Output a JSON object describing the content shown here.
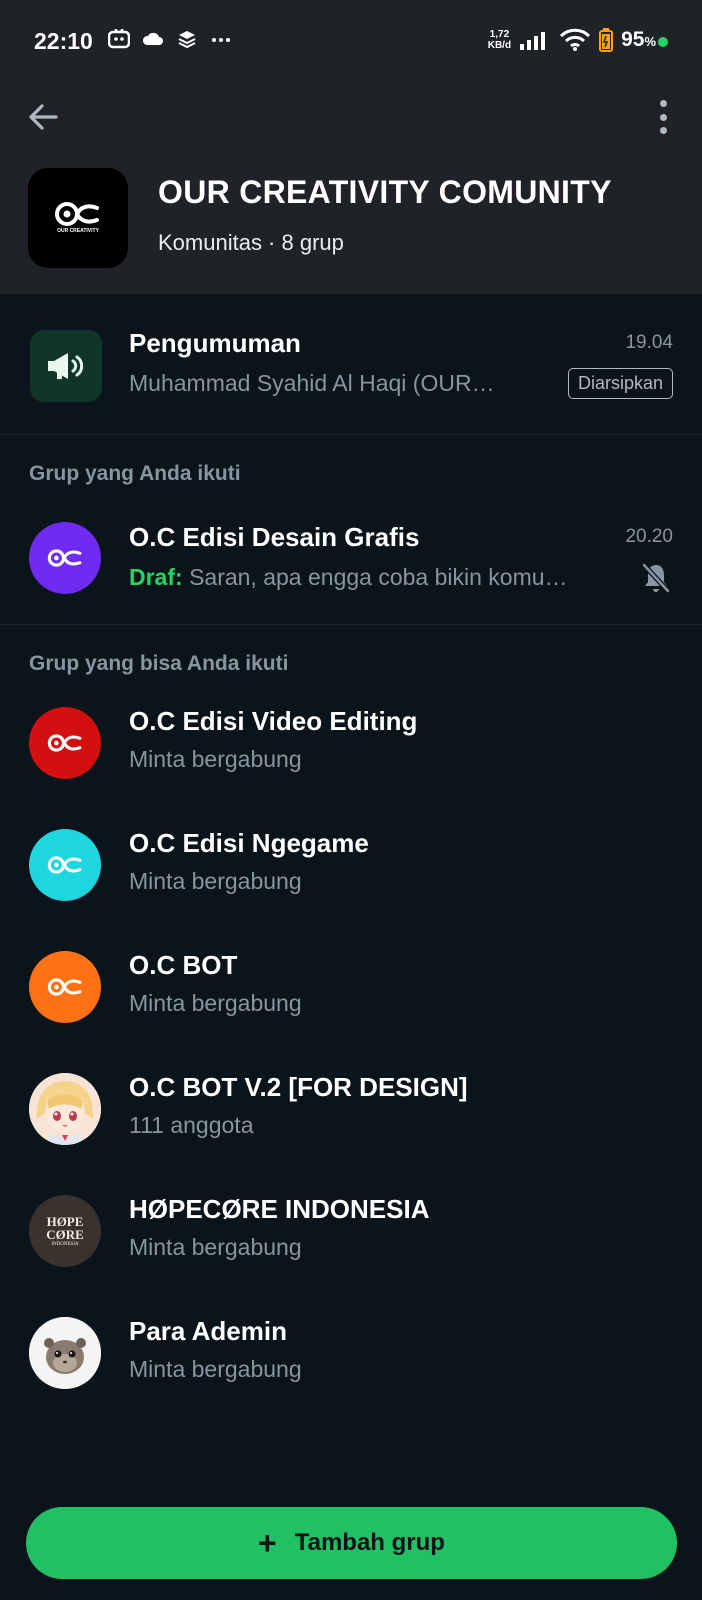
{
  "status_bar": {
    "time": "22:10",
    "net_speed_value": "1,72",
    "net_speed_unit": "KB/d",
    "battery_percent": "95",
    "battery_unit": "%",
    "icons_left": [
      "screen-record-icon",
      "cloud-icon",
      "layers-icon",
      "more-notifications-icon"
    ],
    "icons_right": [
      "signal-icon",
      "wifi-icon",
      "battery-icon"
    ]
  },
  "header": {
    "title": "OUR CREATIVITY COMUNITY",
    "subtitle": "Komunitas · 8 grup",
    "logo_text": "OUR CREATIVITY"
  },
  "announcement": {
    "title": "Pengumuman",
    "last_message": "Muhammad Syahid Al Haqi (OUR…",
    "time": "19.04",
    "badge": "Diarsipkan"
  },
  "sections": {
    "joined_label": "Grup yang Anda ikuti",
    "available_label": "Grup yang bisa Anda ikuti"
  },
  "joined_groups": [
    {
      "name": "O.C Edisi Desain Grafis",
      "draft_label": "Draf:",
      "last_message": "Saran, apa engga coba bikin komu…",
      "time": "20.20",
      "avatar_color": "#6f2bf0",
      "muted": true
    }
  ],
  "available_groups": [
    {
      "name": "O.C Edisi Video Editing",
      "sub": "Minta bergabung",
      "avatar_color": "#d40f0f"
    },
    {
      "name": "O.C Edisi Ngegame",
      "sub": "Minta bergabung",
      "avatar_color": "#1ed6e0"
    },
    {
      "name": "O.C BOT",
      "sub": "Minta bergabung",
      "avatar_color": "#ff7214"
    },
    {
      "name": "O.C BOT V.2 [FOR DESIGN]",
      "sub": "111 anggota",
      "avatar_color": "#f3d9c8"
    },
    {
      "name": "HØPECØRE INDONESIA",
      "sub": "Minta bergabung",
      "avatar_color": "#3a332d",
      "avatar_text_1": "HØPE",
      "avatar_text_2": "CØRE",
      "avatar_text_3": "INDONESIA"
    },
    {
      "name": "Para Ademin",
      "sub": "Minta bergabung",
      "avatar_color": "#f2f2f2"
    }
  ],
  "add_button": {
    "label": "Tambah grup",
    "plus": "+"
  },
  "colors": {
    "background": "#0b141a",
    "header": "#1f2328",
    "accent": "#21c063",
    "secondary_text": "#8696a0"
  }
}
